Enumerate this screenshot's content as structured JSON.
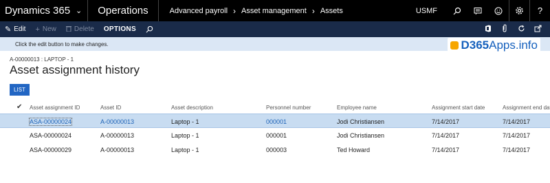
{
  "topbar": {
    "app_name": "Dynamics 365",
    "module": "Operations",
    "breadcrumb": [
      "Advanced payroll",
      "Asset management",
      "Assets"
    ],
    "company": "USMF",
    "icons": [
      "search-icon",
      "message-icon",
      "smiley-icon",
      "gear-icon",
      "help-icon"
    ]
  },
  "actionbar": {
    "edit": "Edit",
    "new": "New",
    "delete": "Delete",
    "options": "OPTIONS",
    "right_icons": [
      "office-icon",
      "attachment-icon",
      "refresh-icon",
      "open-new-window-icon"
    ]
  },
  "message": "Click the edit button to make changes.",
  "logo": {
    "bold": "D365",
    "rest": "Apps.info",
    "mark_color": "#f7a600",
    "text_color": "#1560bd"
  },
  "record_id": "A-00000013 : LAPTOP - 1",
  "page_title": "Asset assignment history",
  "list_tab": "LIST",
  "grid": {
    "columns": [
      "Asset assignment ID",
      "Asset ID",
      "Asset description",
      "Personnel number",
      "Employee name",
      "Assignment start date",
      "Assignment end date"
    ],
    "rows": [
      {
        "selected": true,
        "cells": [
          "ASA-00000024",
          "A-00000013",
          "Laptop - 1",
          "000001",
          "Jodi Christiansen",
          "7/14/2017",
          "7/14/2017"
        ]
      },
      {
        "selected": false,
        "cells": [
          "ASA-00000024",
          "A-00000013",
          "Laptop - 1",
          "000001",
          "Jodi Christiansen",
          "7/14/2017",
          "7/14/2017"
        ]
      },
      {
        "selected": false,
        "cells": [
          "ASA-00000029",
          "A-00000013",
          "Laptop - 1",
          "000003",
          "Ted Howard",
          "7/14/2017",
          "7/14/2017"
        ]
      }
    ]
  },
  "colors": {
    "topbar": "#000000",
    "actionbar": "#1a2b49",
    "message_bar": "#dbe7f5",
    "accent": "#2266c3",
    "selected_row": "#c8dcf1",
    "link": "#1d63b7"
  }
}
